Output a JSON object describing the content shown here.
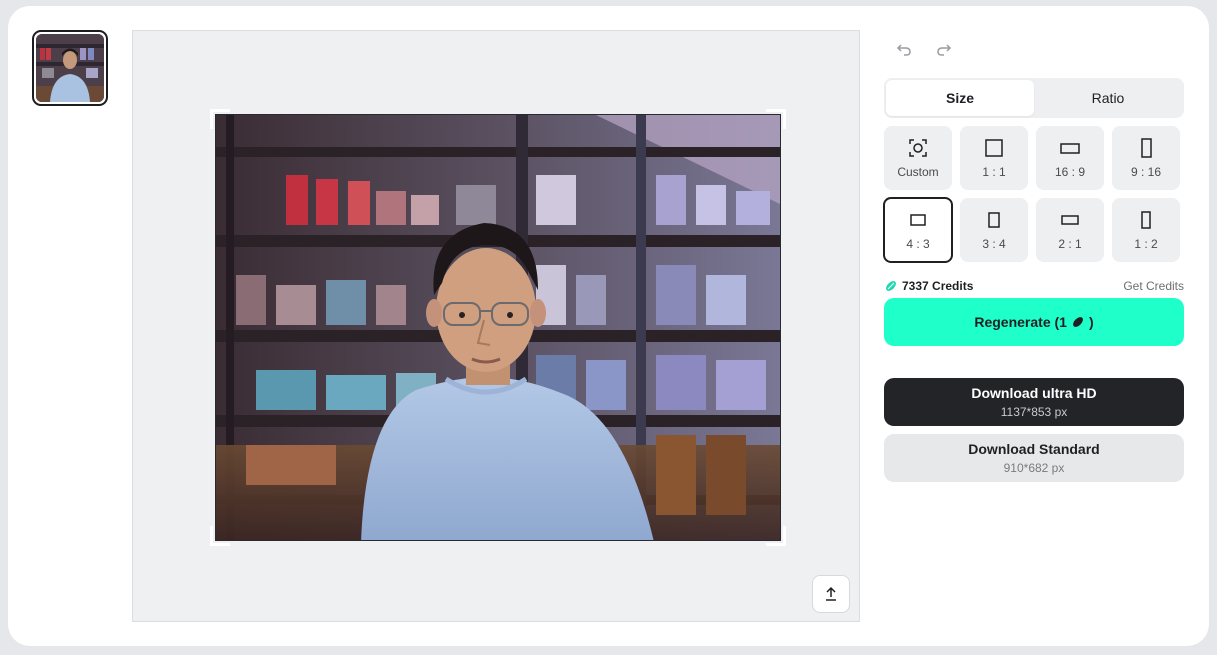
{
  "thumbnail": {
    "alt": "original photo thumbnail"
  },
  "tabs": [
    {
      "label": "Size",
      "active": true
    },
    {
      "label": "Ratio",
      "active": false
    }
  ],
  "ratios": [
    {
      "label": "Custom",
      "icon": "custom-crop-icon"
    },
    {
      "label": "1 : 1",
      "icon": "square-icon"
    },
    {
      "label": "16 : 9",
      "icon": "landscape-wide-icon"
    },
    {
      "label": "9 : 16",
      "icon": "portrait-tall-icon"
    },
    {
      "label": "4 : 3",
      "icon": "landscape-icon",
      "selected": true
    },
    {
      "label": "3 : 4",
      "icon": "portrait-icon"
    },
    {
      "label": "2 : 1",
      "icon": "landscape-2-1-icon"
    },
    {
      "label": "1 : 2",
      "icon": "portrait-1-2-icon"
    }
  ],
  "credits": {
    "amount": "7337 Credits",
    "get_label": "Get Credits"
  },
  "regenerate": {
    "label": "Regenerate (1",
    "suffix": ")"
  },
  "download_hd": {
    "title": "Download ultra HD",
    "size": "1137*853 px"
  },
  "download_std": {
    "title": "Download Standard",
    "size": "910*682 px"
  },
  "colors": {
    "accent": "#1effc9",
    "dark": "#232427"
  }
}
